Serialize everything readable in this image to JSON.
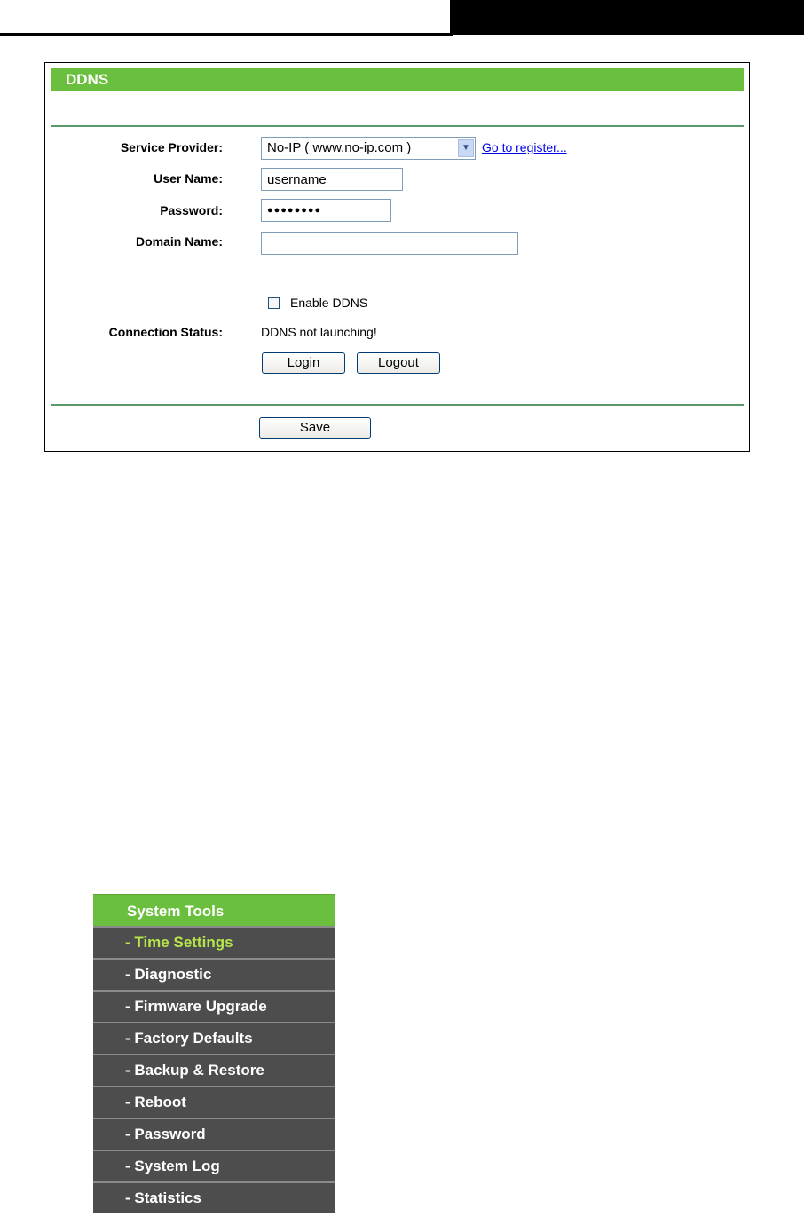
{
  "panel": {
    "title": "DDNS",
    "labels": {
      "service_provider": "Service Provider:",
      "user_name": "User Name:",
      "password": "Password:",
      "domain_name": "Domain Name:",
      "connection_status": "Connection Status:"
    },
    "service_provider_value": "No-IP ( www.no-ip.com )",
    "register_link": "Go to register...",
    "user_name_value": "username",
    "password_value": "●●●●●●●●",
    "domain_name_value": "",
    "enable_ddns_label": "Enable DDNS",
    "enable_ddns_checked": false,
    "connection_status_value": "DDNS not launching!",
    "login_button": "Login",
    "logout_button": "Logout",
    "save_button": "Save"
  },
  "menu": {
    "header": "System Tools",
    "items": [
      {
        "label": "- Time Settings",
        "active": true
      },
      {
        "label": "- Diagnostic",
        "active": false
      },
      {
        "label": "- Firmware Upgrade",
        "active": false
      },
      {
        "label": "- Factory Defaults",
        "active": false
      },
      {
        "label": "- Backup & Restore",
        "active": false
      },
      {
        "label": "- Reboot",
        "active": false
      },
      {
        "label": "- Password",
        "active": false
      },
      {
        "label": "- System Log",
        "active": false
      },
      {
        "label": "- Statistics",
        "active": false
      }
    ]
  },
  "colors": {
    "header_green": "#6bbf3e",
    "menu_gray": "#4d4d4d",
    "active_item": "#b6e64b",
    "link_blue": "#0000ee"
  }
}
